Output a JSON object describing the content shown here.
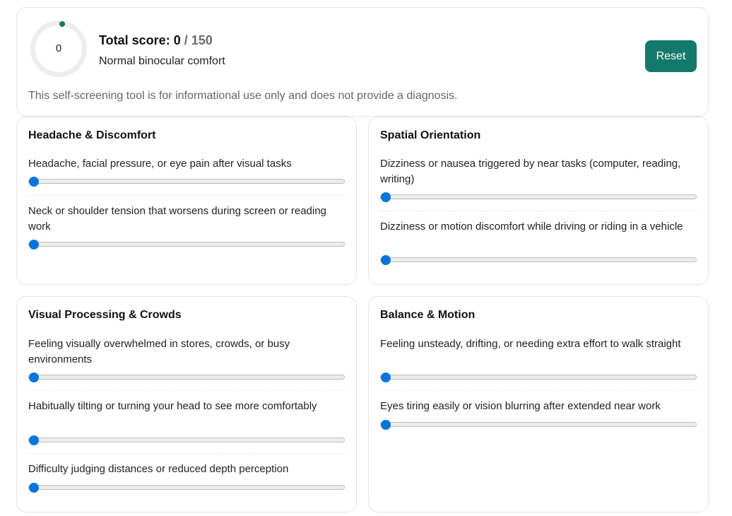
{
  "summary": {
    "ring_value": "0",
    "score_label": "Total score:",
    "score": "0",
    "max_prefix": "/",
    "max": "150",
    "interpretation": "Normal binocular comfort",
    "reset_label": "Reset",
    "disclaimer": "This self-screening tool is for informational use only and does not provide a diagnosis.",
    "accent_color": "#137a6b",
    "slider_color": "#0a74d9"
  },
  "sections": [
    {
      "title": "Headache & Discomfort",
      "items": [
        {
          "label": "Headache, facial pressure, or eye pain after visual tasks",
          "value": 0
        },
        {
          "label": "Neck or shoulder tension that worsens during screen or reading work",
          "value": 0
        }
      ]
    },
    {
      "title": "Spatial Orientation",
      "items": [
        {
          "label": "Dizziness or nausea triggered by near tasks (computer, reading, writing)",
          "value": 0
        },
        {
          "label": "Dizziness or motion discomfort while driving or riding in a vehicle",
          "value": 0
        }
      ]
    },
    {
      "title": "Visual Processing & Crowds",
      "items": [
        {
          "label": "Feeling visually overwhelmed in stores, crowds, or busy environments",
          "value": 0
        },
        {
          "label": "Habitually tilting or turning your head to see more comfortably",
          "value": 0
        },
        {
          "label": "Difficulty judging distances or reduced depth perception",
          "value": 0
        }
      ]
    },
    {
      "title": "Balance & Motion",
      "items": [
        {
          "label": "Feeling unsteady, drifting, or needing extra effort to walk straight",
          "value": 0
        },
        {
          "label": "Eyes tiring easily or vision blurring after extended near work",
          "value": 0
        }
      ]
    }
  ]
}
